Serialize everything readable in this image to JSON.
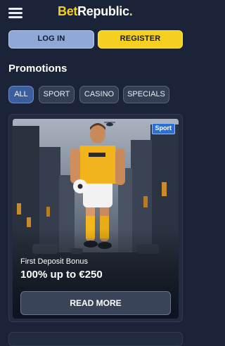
{
  "header": {
    "logo": {
      "part1": "Bet",
      "part2": "Republic",
      "part3": "."
    },
    "menu_icon": "hamburger-menu-icon"
  },
  "auth": {
    "login_label": "LOG IN",
    "register_label": "REGISTER"
  },
  "page": {
    "title": "Promotions"
  },
  "filters": [
    {
      "label": "ALL",
      "active": true
    },
    {
      "label": "SPORT",
      "active": false
    },
    {
      "label": "CASINO",
      "active": false
    },
    {
      "label": "SPECIALS",
      "active": false
    }
  ],
  "promotions": [
    {
      "badge": "Sport",
      "subtitle": "First Deposit Bonus",
      "title": "100% up to €250",
      "cta_label": "READ MORE"
    }
  ],
  "colors": {
    "background": "#1a2338",
    "accent_yellow": "#f5d020",
    "login_blue": "#8fa8d6",
    "active_filter": "#3b5e9e",
    "badge_blue": "#2b6fd8"
  }
}
